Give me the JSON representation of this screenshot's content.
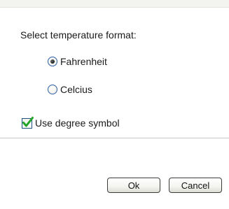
{
  "dialog": {
    "prompt": "Select temperature format:",
    "options": [
      {
        "label": "Fahrenheit",
        "selected": true
      },
      {
        "label": "Celcius",
        "selected": false
      }
    ],
    "degree_symbol": {
      "label": "Use degree symbol",
      "checked": true
    },
    "buttons": {
      "ok_label": "Ok",
      "cancel_label": "Cancel"
    }
  },
  "colors": {
    "radio_border": "#2e5fa8",
    "checkbox_border": "#1c5180",
    "checkmark": "#22a32a"
  },
  "icons": {
    "checkmark": "checkmark-icon"
  }
}
